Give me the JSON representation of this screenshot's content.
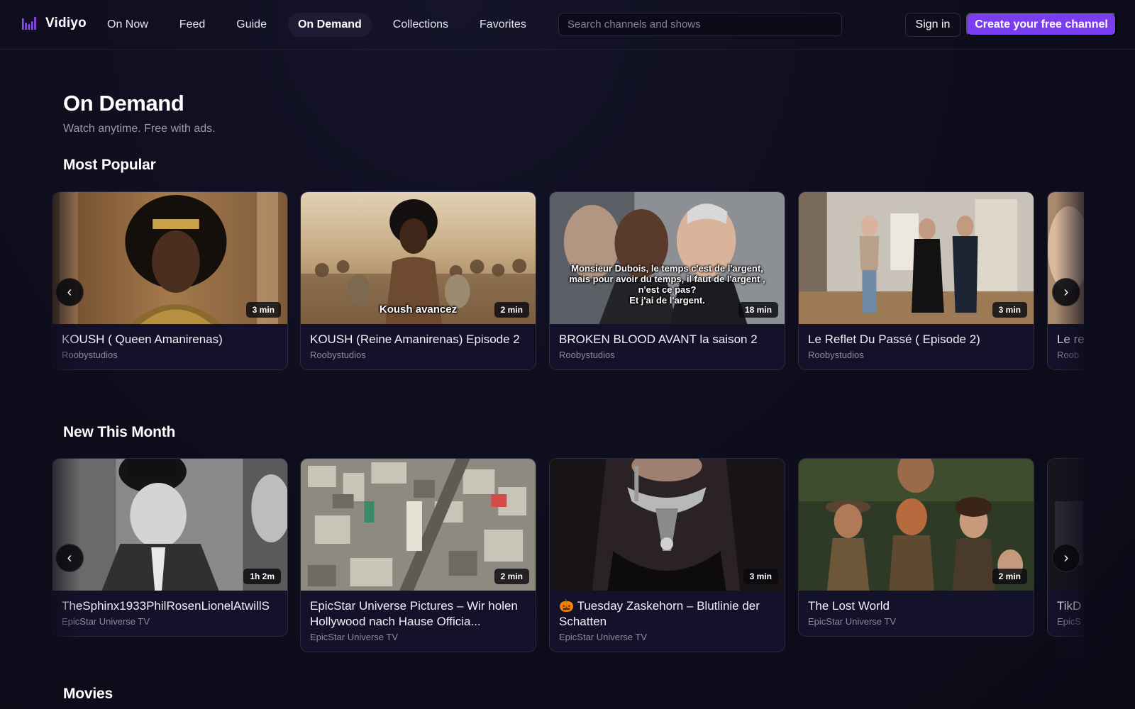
{
  "brand": {
    "name": "Vidiyo",
    "accent": "#7a3ef0"
  },
  "nav": {
    "items": [
      {
        "label": "On Now"
      },
      {
        "label": "Feed"
      },
      {
        "label": "Guide"
      },
      {
        "label": "On Demand",
        "active": true
      },
      {
        "label": "Collections"
      },
      {
        "label": "Favorites"
      }
    ],
    "search_placeholder": "Search channels and shows",
    "signin_label": "Sign in",
    "create_label": "Create your free channel"
  },
  "page": {
    "title": "On Demand",
    "subtitle": "Watch anytime. Free with ads."
  },
  "sections": {
    "popular": {
      "title": "Most Popular",
      "cards": [
        {
          "title": "KOUSH ( Queen Amanirenas)",
          "channel": "Roobystudios",
          "duration": "3 min"
        },
        {
          "title": "KOUSH (Reine Amanirenas) Episode 2",
          "channel": "Roobystudios",
          "duration": "2 min",
          "subtitle_text": "Koush avancez"
        },
        {
          "title": "BROKEN BLOOD AVANT la saison 2",
          "channel": "Roobystudios",
          "duration": "18 min",
          "subtitle_lines": [
            "Monsieur Dubois, le temps c'est de l'argent,",
            "mais pour avoir du temps, il faut de l'argent ,",
            "n'est ce pas?",
            "Et j'ai de l'argent."
          ]
        },
        {
          "title": "Le Reflet Du Passé ( Episode 2)",
          "channel": "Roobystudios",
          "duration": "3 min"
        },
        {
          "title": "Le re",
          "channel": "Roob"
        }
      ]
    },
    "new_month": {
      "title": "New This Month",
      "cards": [
        {
          "title": "TheSphinx1933PhilRosenLionelAtwillS",
          "channel": "EpicStar Universe TV",
          "duration": "1h 2m"
        },
        {
          "title": "EpicStar Universe Pictures – Wir holen Hollywood nach Hause Officia...",
          "channel": "EpicStar Universe TV",
          "duration": "2 min"
        },
        {
          "title": "🎃 Tuesday Zaskehorn – Blutlinie der Schatten",
          "channel": "EpicStar Universe TV",
          "duration": "3 min"
        },
        {
          "title": "The Lost World",
          "channel": "EpicStar Universe TV",
          "duration": "2 min"
        },
        {
          "title": "TikD",
          "channel": "EpicS"
        }
      ]
    },
    "movies": {
      "title": "Movies"
    }
  },
  "carousel": {
    "prev_glyph": "‹",
    "next_glyph": "›"
  }
}
